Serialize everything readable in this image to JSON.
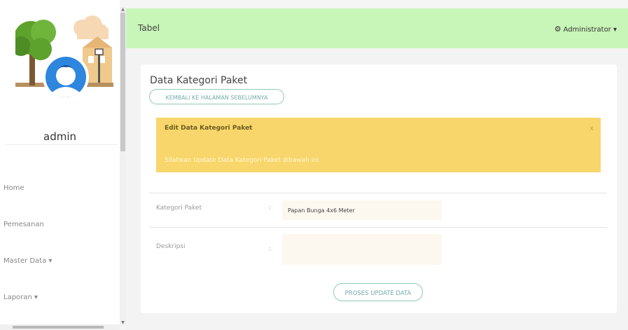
{
  "sidebar": {
    "username": "admin",
    "items": [
      {
        "label": "Home"
      },
      {
        "label": "Pemesanan"
      },
      {
        "label": "Master Data ▾"
      },
      {
        "label": "Laporan ▾"
      }
    ]
  },
  "header": {
    "title": "Tabel",
    "user_menu_label": "Administrator ▾"
  },
  "card": {
    "title": "Data Kategori Paket",
    "back_button_label": "KEMBALI KE HALAMAN SEBELUMNYA",
    "alert": {
      "title": "Edit Data Kategori Paket",
      "close": "x",
      "message": "Silahkan Update Data Kategori Paket dibawah ini."
    },
    "form": {
      "fields": [
        {
          "label": "Kategori Paket",
          "colon": ":",
          "value": "Papan Bunga 4x6 Meter"
        },
        {
          "label": "Deskripsi",
          "colon": ":",
          "value": ""
        }
      ],
      "submit_label": "PROSES UPDATE DATA"
    }
  },
  "colors": {
    "header_bg": "#c8f5b8",
    "alert_bg": "#f8d66b",
    "button_border": "#8fc9b8"
  },
  "icons": {
    "user_menu": "gear-icon",
    "avatar": "user-avatar-icon"
  }
}
